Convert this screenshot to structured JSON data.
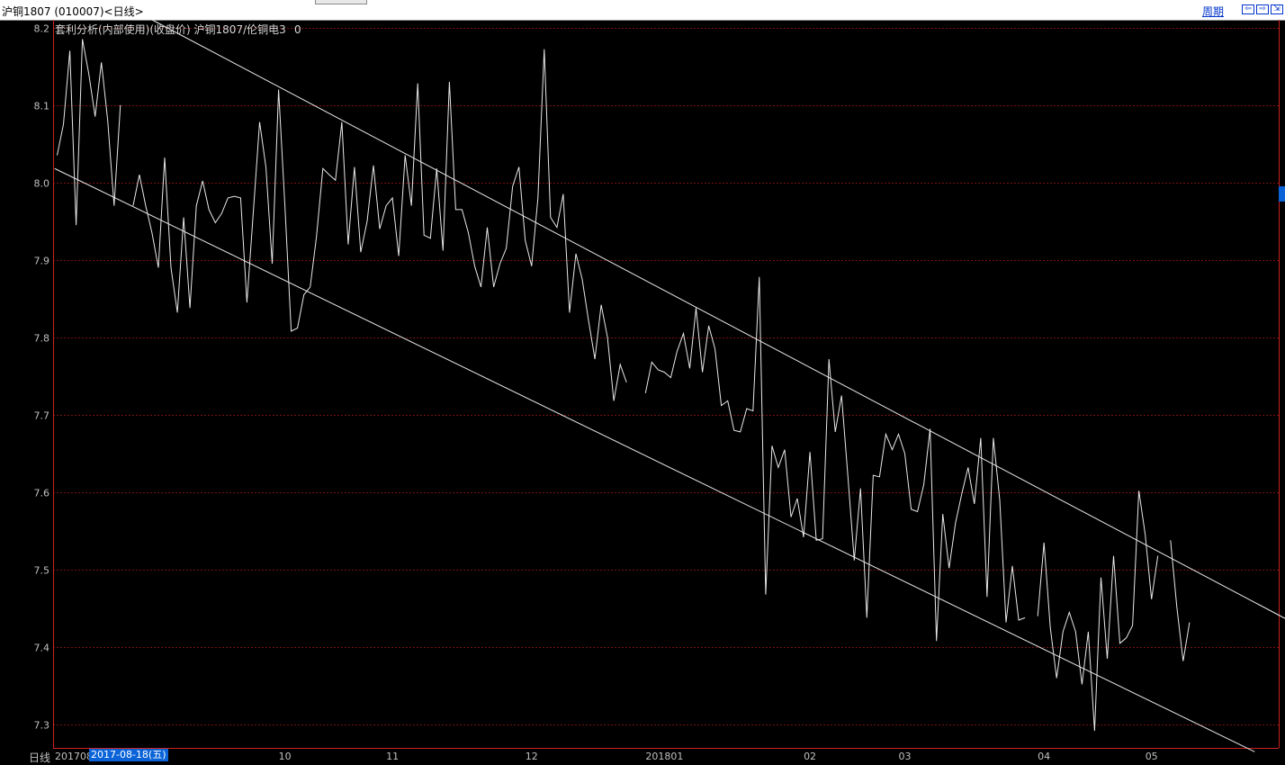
{
  "window": {
    "title": "沪铜1807 (010007)<日线>",
    "period_button": "周期",
    "nav_icons": [
      "arrow-left-icon",
      "arrow-right-icon",
      "scroll-right-icon"
    ],
    "nav_glyphs": [
      "⇦",
      "⇨",
      "⇲"
    ]
  },
  "chart_header": {
    "indicator": "套利分析(内部使用)(收盘价) 沪铜1807/伦铜电3",
    "value": "0"
  },
  "period_label": "日线",
  "selected_date": "2017-08-18(五)",
  "colors": {
    "background": "#000000",
    "frame": "#cc2222",
    "grid": "#7a1010",
    "line": "#e8e8e8",
    "axis_text": "#c0c0c0",
    "highlight": "#0a64d8"
  },
  "chart_data": {
    "type": "line",
    "ylim": [
      7.27,
      8.21
    ],
    "yticks": [
      7.3,
      7.4,
      7.5,
      7.6,
      7.7,
      7.8,
      7.9,
      8.0,
      8.1,
      8.2
    ],
    "grid": true,
    "x_tick_labels": [
      {
        "label": "201708",
        "index": 0
      },
      {
        "label": "10",
        "index": 36
      },
      {
        "label": "11",
        "index": 53
      },
      {
        "label": "12",
        "index": 75
      },
      {
        "label": "201801",
        "index": 96
      },
      {
        "label": "02",
        "index": 119
      },
      {
        "label": "03",
        "index": 134
      },
      {
        "label": "04",
        "index": 156
      },
      {
        "label": "05",
        "index": 173
      }
    ],
    "series": [
      {
        "values": [
          8.035,
          8.075,
          8.17,
          7.945,
          8.185,
          8.14,
          8.085,
          8.155,
          8.08,
          7.97,
          8.1,
          null,
          7.97,
          8.01,
          7.97,
          7.935,
          7.89,
          8.032,
          7.89,
          7.832,
          7.955,
          7.838,
          7.97,
          8.002,
          7.965,
          7.948,
          7.96,
          7.98,
          7.982,
          7.98,
          7.845,
          7.96,
          8.078,
          8.02,
          7.895,
          8.12,
          7.97,
          7.808,
          7.812,
          7.855,
          7.865,
          7.93,
          8.018,
          8.01,
          8.003,
          8.078,
          7.92,
          8.02,
          7.91,
          7.95,
          8.022,
          7.94,
          7.97,
          7.98,
          7.905,
          8.035,
          7.97,
          8.128,
          7.932,
          7.928,
          8.018,
          7.912,
          8.13,
          7.965,
          7.965,
          7.935,
          7.892,
          7.865,
          7.942,
          7.865,
          7.895,
          7.915,
          7.995,
          8.02,
          7.925,
          7.892,
          7.98,
          8.172,
          7.955,
          7.942,
          7.985,
          7.832,
          7.908,
          7.875,
          7.822,
          7.772,
          7.842,
          7.8,
          7.718,
          7.765,
          7.742,
          null,
          null,
          7.728,
          7.768,
          7.758,
          7.755,
          7.748,
          7.782,
          7.805,
          7.76,
          7.838,
          7.755,
          7.815,
          7.785,
          7.712,
          7.718,
          7.68,
          7.678,
          7.708,
          7.705,
          7.878,
          7.468,
          7.66,
          7.632,
          7.655,
          7.568,
          7.592,
          7.542,
          7.652,
          7.538,
          7.54,
          7.772,
          7.678,
          7.725,
          7.62,
          7.512,
          7.605,
          7.438,
          7.622,
          7.62,
          7.675,
          7.655,
          7.675,
          7.65,
          7.578,
          7.575,
          7.61,
          7.682,
          7.408,
          7.572,
          7.502,
          7.56,
          7.598,
          7.632,
          7.585,
          7.67,
          7.465,
          7.67,
          7.59,
          7.432,
          7.505,
          7.435,
          7.438,
          null,
          7.44,
          7.535,
          7.425,
          7.36,
          7.42,
          7.445,
          7.42,
          7.352,
          7.42,
          7.292,
          7.49,
          7.385,
          7.518,
          7.405,
          7.412,
          7.428,
          7.602,
          7.545,
          7.462,
          7.518,
          null,
          7.538,
          7.452,
          7.382,
          7.432
        ]
      }
    ],
    "trend_lines": [
      {
        "name": "upper channel",
        "start": {
          "index": 15,
          "value": 8.21
        },
        "end": {
          "index": 194.6,
          "value": 7.435
        }
      },
      {
        "name": "lower channel",
        "start": {
          "index": -0.4,
          "value": 8.018
        },
        "end": {
          "index": 189.3,
          "value": 7.265
        }
      }
    ]
  }
}
